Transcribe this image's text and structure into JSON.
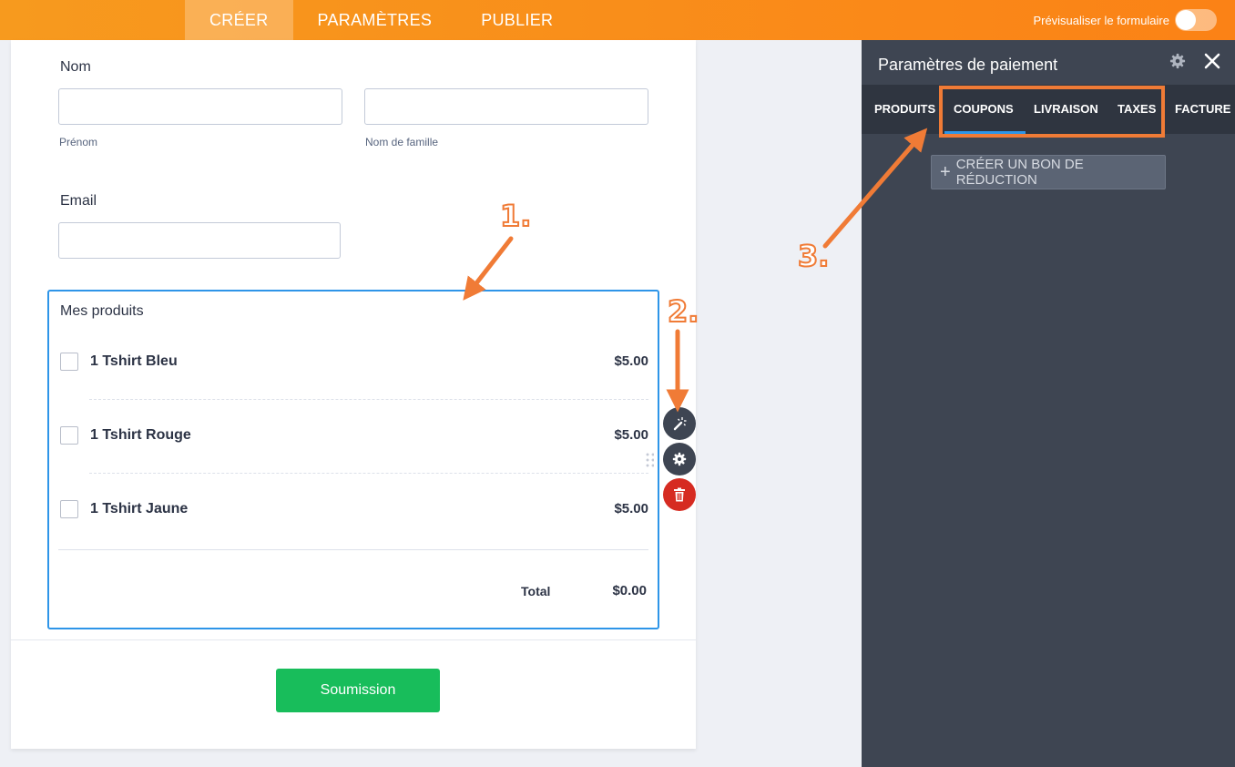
{
  "topbar": {
    "tabs": [
      "CRÉER",
      "PARAMÈTRES",
      "PUBLIER"
    ],
    "preview_label": "Prévisualiser le formulaire"
  },
  "form": {
    "name_label": "Nom",
    "first_name_sublabel": "Prénom",
    "last_name_sublabel": "Nom de famille",
    "email_label": "Email",
    "products_title": "Mes produits",
    "products": [
      {
        "name": "1 Tshirt Bleu",
        "price": "$5.00"
      },
      {
        "name": "1 Tshirt Rouge",
        "price": "$5.00"
      },
      {
        "name": "1 Tshirt Jaune",
        "price": "$5.00"
      }
    ],
    "total_label": "Total",
    "total_value": "$0.00",
    "submit_label": "Soumission"
  },
  "panel": {
    "title": "Paramètres de paiement",
    "tabs": [
      "PRODUITS",
      "COUPONS",
      "LIVRAISON",
      "TAXES",
      "FACTURE"
    ],
    "active_tab": "COUPONS",
    "create_button": "CRÉER UN BON DE RÉDUCTION"
  },
  "annotations": [
    "1.",
    "2.",
    "3."
  ],
  "colors": {
    "topbar": "#fb8216",
    "panel": "#3e4552",
    "tab_active_underline": "#2e95e8",
    "submit": "#18bd5b",
    "annotation": "#f07b36",
    "delete": "#d62b21"
  }
}
